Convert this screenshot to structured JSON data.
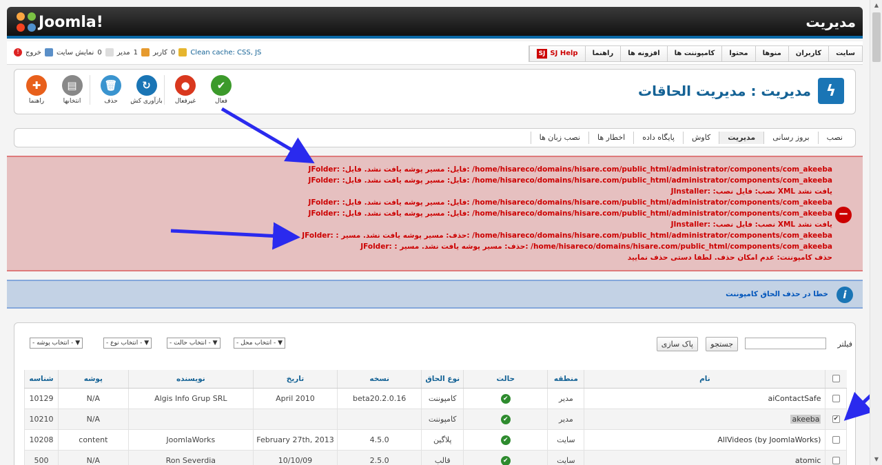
{
  "brand": {
    "logo_text": "Joomla!",
    "admin_title": "مدیریت"
  },
  "status_bar": {
    "cache": "Clean cache: CSS, JS",
    "users_count": "0",
    "users_label": "کاربر",
    "admins_count": "1",
    "admins_label": "مدیر",
    "messages_count": "0",
    "view_site": "نمایش سایت",
    "logout": "خروج"
  },
  "menu": [
    "سایت",
    "کاربران",
    "منوها",
    "محتوا",
    "کامپوننت ها",
    "افزونه ها",
    "راهنما"
  ],
  "sj_help": {
    "badge": "SJ",
    "label": "SJ Help"
  },
  "toolbar": {
    "items": [
      {
        "label": "راهنما",
        "icon": "help-icon",
        "color": "#e8601c"
      },
      {
        "label": "انتخابها",
        "icon": "options-icon",
        "color": "#888888"
      },
      {
        "label": "حذف",
        "icon": "trash-icon",
        "color": "#3a94cf"
      },
      {
        "label": "بازآوری کش",
        "icon": "refresh-icon",
        "color": "#1a75b5"
      },
      {
        "label": "غیرفعال",
        "icon": "disable-icon",
        "color": "#d9381e"
      },
      {
        "label": "فعال",
        "icon": "enable-icon",
        "color": "#3c9a2b"
      }
    ],
    "page_title": "مدیریت : مدیریت الحاقات"
  },
  "subnav": [
    "نصب",
    "بروز رسانی",
    "مدیریت",
    "کاوش",
    "پایگاه داده",
    "اخطار ها",
    "نصب زبان ها"
  ],
  "subnav_active": "مدیریت",
  "errors": [
    "JFolder: :فایل: مسیر پوشه یافت نشد. فایل: /home/hisareco/domains/hisare.com/public_html/administrator/components/com_akeeba",
    "JFolder: :فایل: مسیر پوشه یافت نشد. فایل: /home/hisareco/domains/hisare.com/public_html/administrator/components/com_akeeba",
    "JInstaller: :نصب: فایل نصب XML یافت نشد",
    "JFolder: :فایل: مسیر پوشه یافت نشد. فایل: /home/hisareco/domains/hisare.com/public_html/administrator/components/com_akeeba",
    "JFolder: :فایل: مسیر پوشه یافت نشد. فایل: /home/hisareco/domains/hisare.com/public_html/administrator/components/com_akeeba",
    "JInstaller: :نصب: فایل نصب XML یافت نشد",
    "JFolder: : حذف: مسیر پوشه یافت نشد. مسیر: /home/hisareco/domains/hisare.com/public_html/administrator/components/com_akeeba",
    "JFolder: : حذف: مسیر پوشه یافت نشد. مسیر: /home/hisareco/domains/hisare.com/public_html/components/com_akeeba",
    "حذف کامپوننت: عدم امکان حذف. لطفا دستی حذف نمایید"
  ],
  "info": "خطا در حذف الحاق کامپوننت",
  "filters": {
    "label": "فیلتر",
    "search_btn": "جستجو",
    "clear_btn": "پاک سازی",
    "selects": [
      "- انتخاب محل -",
      "- انتخاب حالت -",
      "- انتخاب نوع -",
      "- انتخاب پوشه -"
    ]
  },
  "table": {
    "headers": [
      "نام",
      "منطقه",
      "حالت",
      "نوع الحاق",
      "نسخه",
      "تاریخ",
      "نویسنده",
      "پوشه",
      "شناسه"
    ],
    "rows": [
      {
        "name": "aiContactSafe",
        "area": "مدیر",
        "type": "کامپوننت",
        "version": "beta20.2.0.16",
        "date": "April 2010",
        "author": "Algis Info Grup SRL",
        "folder": "N/A",
        "id": "10129",
        "checked": false
      },
      {
        "name": "akeeba",
        "area": "مدیر",
        "type": "کامپوننت",
        "version": "",
        "date": "",
        "author": "",
        "folder": "N/A",
        "id": "10210",
        "checked": true
      },
      {
        "name": "(AllVideos (by JoomlaWorks",
        "area": "سایت",
        "type": "پلاگین",
        "version": "4.5.0",
        "date": "February 27th, 2013",
        "author": "JoomlaWorks",
        "folder": "content",
        "id": "10208",
        "checked": false
      },
      {
        "name": "atomic",
        "area": "سایت",
        "type": "قالب",
        "version": "2.5.0",
        "date": "10/10/09",
        "author": "Ron Severdia",
        "folder": "N/A",
        "id": "500",
        "checked": false
      }
    ]
  },
  "colors": {
    "accent": "#146295",
    "error": "#cc0000",
    "arrow": "#2a2aee"
  }
}
